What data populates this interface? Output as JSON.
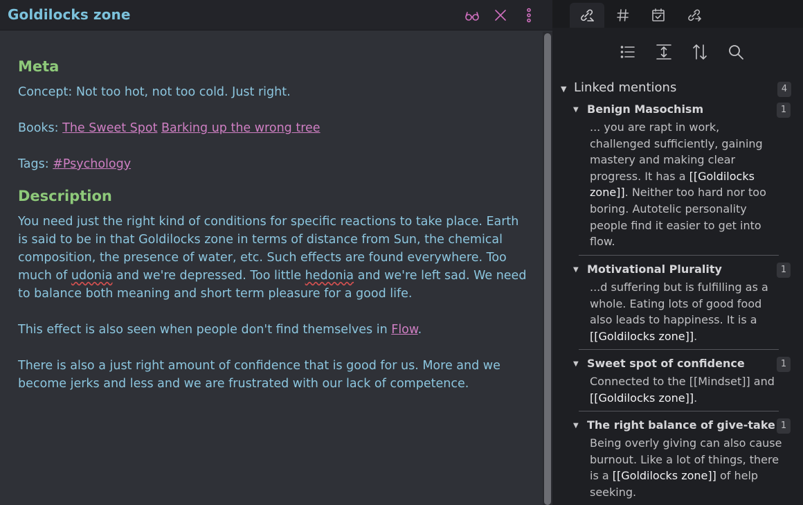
{
  "note": {
    "title": "Goldilocks zone",
    "meta_heading": "Meta",
    "concept": "Concept: Not too hot, not too cold. Just right.",
    "books_label": "Books:",
    "book_links": [
      "The Sweet Spot",
      "Barking up the wrong tree"
    ],
    "tags_label": "Tags:",
    "tag": "#Psychology",
    "description_heading": "Description",
    "para1_part1": "You need just the right kind of conditions for specific reactions to take place. Earth is said to be in that Goldilocks zone in terms of distance from Sun, the chemical composition, the presence of water, etc. Such effects are found everywhere. Too much of ",
    "para1_word1": "udonia",
    "para1_part2": " and we're depressed. Too little ",
    "para1_word2": "hedonia",
    "para1_part3": " and we're left sad. We need to balance both meaning and short term pleasure for a good life.",
    "para2_text": "This effect is also seen when people don't find themselves in ",
    "para2_link": "Flow",
    "para2_end": ".",
    "para3": "There is also a just right amount of confidence that is good for us. More and we become jerks and less and we are frustrated with our lack of competence."
  },
  "toolbar_icons": [
    "glasses-icon",
    "close-icon",
    "more-vertical-icon"
  ],
  "sidebar": {
    "tabs": [
      "linked-references-icon",
      "hashtag-icon",
      "calendar-check-icon",
      "unlinked-references-icon"
    ],
    "tools": [
      "list-icon",
      "expand-vertical-icon",
      "sort-icon",
      "search-icon"
    ],
    "linked_mentions": {
      "label": "Linked mentions",
      "count": "4",
      "items": [
        {
          "title": "Benign Masochism",
          "count": "1",
          "before": "... you are rapt in work, challenged sufficiently, gaining mastery and making clear progress. It has a ",
          "ref": "[[Goldilocks zone]]",
          "after": ". Neither too hard nor too boring. Autotelic personality people find it easier to get into flow."
        },
        {
          "title": "Motivational Plurality",
          "count": "1",
          "before": "...d suffering but is fulfilling as a whole. Eating lots of good food also leads to happiness. It is a ",
          "ref": "[[Goldilocks zone]]",
          "after": "."
        },
        {
          "title": "Sweet spot of confidence",
          "count": "1",
          "before": "Connected to the [[Mindset]] and ",
          "ref": "[[Goldilocks zone]]",
          "after": "."
        },
        {
          "title": "The right balance of give-take",
          "count": "1",
          "before": "Being overly giving can also cause burnout. Like a lot of things, there is a ",
          "ref": "[[Goldilocks zone]]",
          "after": " of help seeking."
        }
      ]
    }
  },
  "colors": {
    "title": "#7cc2dc",
    "heading": "#8ec97a",
    "body_text": "#8cc6df",
    "link": "#cf7fc3",
    "editor_bg": "#2f3137",
    "sidebar_bg": "#1e1f23"
  }
}
